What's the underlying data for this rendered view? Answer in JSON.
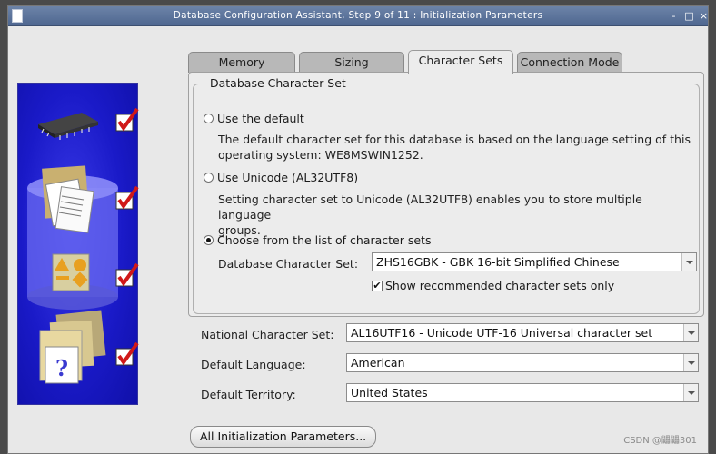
{
  "window": {
    "title": "Database Configuration Assistant, Step 9 of 11 : Initialization Parameters",
    "controls": [
      "-",
      "□",
      "×"
    ]
  },
  "tabs": [
    {
      "label": "Memory",
      "active": false
    },
    {
      "label": "Sizing",
      "active": false
    },
    {
      "label": "Character Sets",
      "active": true
    },
    {
      "label": "Connection Mode",
      "active": false
    }
  ],
  "charset_group": {
    "title": "Database Character Set",
    "option_default": {
      "label": "Use the default",
      "desc_line1": "The default character set for this database is based on the language setting of this",
      "desc_line2": "operating system: WE8MSWIN1252.",
      "selected": false
    },
    "option_unicode": {
      "label": "Use Unicode (AL32UTF8)",
      "desc_line1": "Setting character set to Unicode (AL32UTF8) enables you to store multiple language",
      "desc_line2": "groups.",
      "selected": false
    },
    "option_list": {
      "label": "Choose from the list of character sets",
      "selected": true
    },
    "db_charset_label": "Database Character Set:",
    "db_charset_value": "ZHS16GBK - GBK 16-bit Simplified Chinese",
    "show_recommended_label": "Show recommended character sets only",
    "show_recommended_checked": true
  },
  "national": {
    "label": "National Character Set:",
    "value": "AL16UTF16 - Unicode UTF-16 Universal character set"
  },
  "language": {
    "label": "Default Language:",
    "value": "American"
  },
  "territory": {
    "label": "Default Territory:",
    "value": "United States"
  },
  "buttons": {
    "all_params": "All Initialization Parameters..."
  },
  "watermark": "CSDN @鼺鼺301",
  "colors": {
    "graphic_blue": "#1a1ac8",
    "check_red": "#d01818",
    "titlebar": "#5a7098"
  },
  "icons": [
    "chip-icon",
    "documents-folder-icon",
    "database-cylinder-icon",
    "shapes-icon",
    "question-document-icon",
    "checkmark-icon"
  ]
}
